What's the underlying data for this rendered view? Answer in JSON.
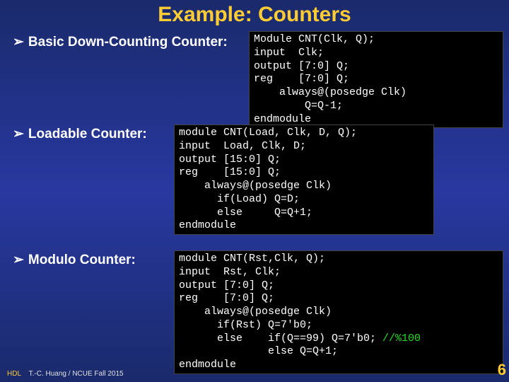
{
  "title": "Example: Counters",
  "bullets": {
    "b1": "Basic Down-Counting Counter:",
    "b2": "Loadable Counter:",
    "b3": "Modulo Counter:"
  },
  "code": {
    "c1": "Module CNT(Clk, Q);\ninput  Clk;\noutput [7:0] Q;\nreg    [7:0] Q;\n    always@(posedge Clk)\n        Q=Q-1;\nendmodule",
    "c2": "module CNT(Load, Clk, D, Q);\ninput  Load, Clk, D;\noutput [15:0] Q;\nreg    [15:0] Q;\n    always@(posedge Clk)\n      if(Load) Q=D;\n      else     Q=Q+1;\nendmodule",
    "c3_pre": "module CNT(Rst,Clk, Q);\ninput  Rst, Clk;\noutput [7:0] Q;\nreg    [7:0] Q;\n    always@(posedge Clk)\n      if(Rst) Q=7'b0;\n      else    if(Q==99) Q=7'b0; ",
    "c3_comment": "//%100",
    "c3_post": "\n              else Q=Q+1;\nendmodule"
  },
  "footer": {
    "hdl": "HDL",
    "credit": "T.-C. Huang / NCUE Fall 2015"
  },
  "pagenum": "6",
  "chart_data": {
    "type": "table",
    "title": "Verilog counter code examples",
    "rows": [
      {
        "name": "Basic Down-Counting Counter",
        "module": "CNT(Clk, Q)",
        "width": "[7:0]",
        "behavior": "Q=Q-1 on posedge Clk"
      },
      {
        "name": "Loadable Counter",
        "module": "CNT(Load, Clk, D, Q)",
        "width": "[15:0]",
        "behavior": "if Load Q=D else Q=Q+1"
      },
      {
        "name": "Modulo Counter",
        "module": "CNT(Rst, Clk, Q)",
        "width": "[7:0]",
        "behavior": "if Rst Q=0 else if Q==99 Q=0 else Q=Q+1 (mod 100)"
      }
    ]
  }
}
